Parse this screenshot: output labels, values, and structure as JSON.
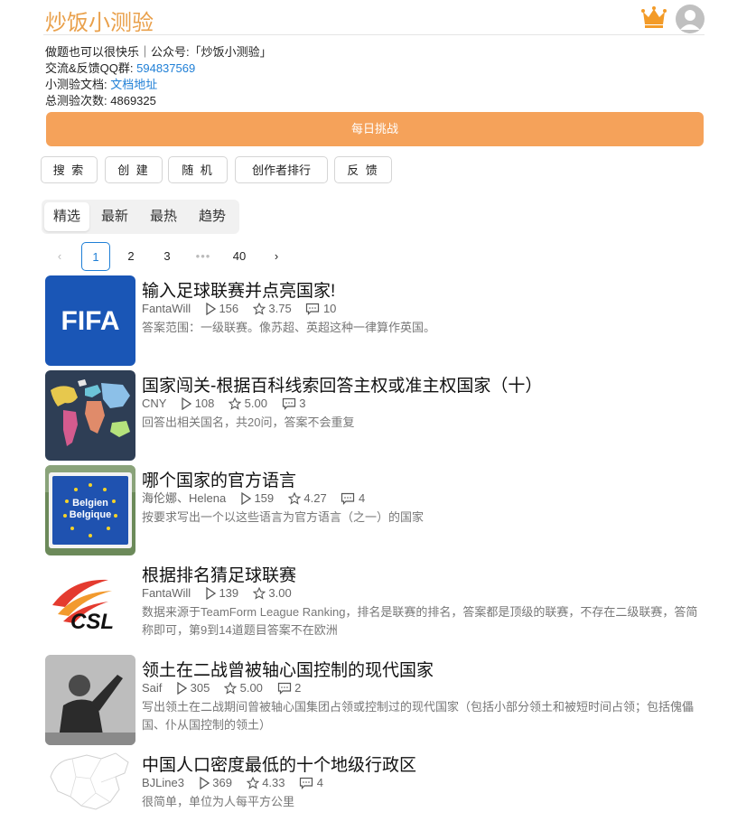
{
  "site": {
    "title": "炒饭小测验"
  },
  "info": {
    "line1": "做题也可以很快乐｜公众号:「炒饭小测验」",
    "qq_label": "交流&反馈QQ群:",
    "qq_value": "594837569",
    "docs_label": "小测验文档:",
    "docs_link": "文档地址",
    "count_label": "总测验次数:",
    "count_value": "4869325"
  },
  "daily_button": "每日挑战",
  "actions": [
    "搜 索",
    "创 建",
    "随 机",
    "创作者排行",
    "反 馈"
  ],
  "tabs": [
    "精选",
    "最新",
    "最热",
    "趋势"
  ],
  "pagination": {
    "pages": [
      "1",
      "2",
      "3",
      "40"
    ],
    "current": "1",
    "dots": "•••",
    "prev": "‹",
    "next": "›"
  },
  "quizzes": [
    {
      "title": "输入足球联赛并点亮国家!",
      "author": "FantaWill",
      "plays": "156",
      "rating": "3.75",
      "comments": "10",
      "desc": "答案范围：一级联赛。像苏超、英超这种一律算作英国。",
      "thumb_text": "FIFA"
    },
    {
      "title": "国家闯关-根据百科线索回答主权或准主权国家（十）",
      "author": "CNY",
      "plays": "108",
      "rating": "5.00",
      "comments": "3",
      "desc": "回答出相关国名，共20问，答案不会重复"
    },
    {
      "title": "哪个国家的官方语言",
      "author": "海伦娜、Helena",
      "plays": "159",
      "rating": "4.27",
      "comments": "4",
      "desc": "按要求写出一个以这些语言为官方语言（之一）的国家",
      "thumb_text_1": "Belgien",
      "thumb_text_2": "Belgique"
    },
    {
      "title": "根据排名猜足球联赛",
      "author": "FantaWill",
      "plays": "139",
      "rating": "3.00",
      "comments": "",
      "desc": "数据来源于TeamForm League Ranking，排名是联赛的排名，答案都是顶级的联赛，不存在二级联赛，答简称即可，第9到14道题目答案不在欧洲",
      "thumb_text": "CSL"
    },
    {
      "title": "领土在二战曾被轴心国控制的现代国家",
      "author": "Saif",
      "plays": "305",
      "rating": "5.00",
      "comments": "2",
      "desc": "写出领土在二战期间曾被轴心国集团占领或控制过的现代国家（包括小部分领土和被短时间占领；包括傀儡国、仆从国控制的领土）"
    },
    {
      "title": "中国人口密度最低的十个地级行政区",
      "author": "BJLine3",
      "plays": "369",
      "rating": "4.33",
      "comments": "4",
      "desc": "很简单，单位为人每平方公里"
    }
  ]
}
